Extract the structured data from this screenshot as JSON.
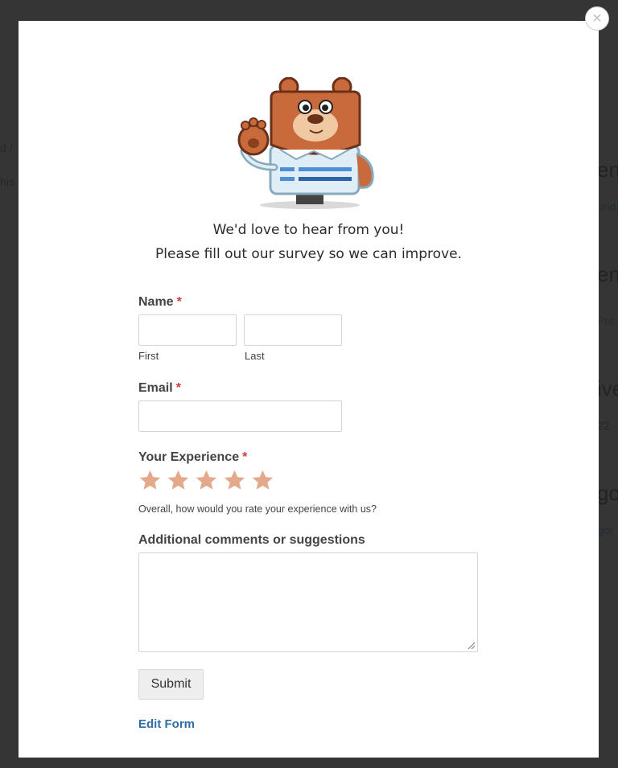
{
  "background": {
    "fragments": [
      "d / ",
      "his t",
      "ent",
      "orld",
      "ent",
      "Pre",
      "ive",
      "22",
      "go",
      "gor"
    ]
  },
  "modal": {
    "close_label": "×",
    "intro_line1": "We'd love to hear from you!",
    "intro_line2": "Please fill out our survey so we can improve."
  },
  "form": {
    "name": {
      "label": "Name",
      "required_mark": "*",
      "first_sublabel": "First",
      "last_sublabel": "Last",
      "first_value": "",
      "last_value": ""
    },
    "email": {
      "label": "Email",
      "required_mark": "*",
      "value": ""
    },
    "experience": {
      "label": "Your Experience",
      "required_mark": "*",
      "stars_total": 5,
      "rating": 0,
      "star_color": "#e3a98a",
      "description": "Overall, how would you rate your experience with us?"
    },
    "comments": {
      "label": "Additional comments or suggestions",
      "value": ""
    },
    "submit_label": "Submit",
    "edit_link": "Edit Form"
  },
  "colors": {
    "required": "#d63637",
    "link": "#2d6ea8",
    "mascot_fur": "#c86a3c"
  }
}
